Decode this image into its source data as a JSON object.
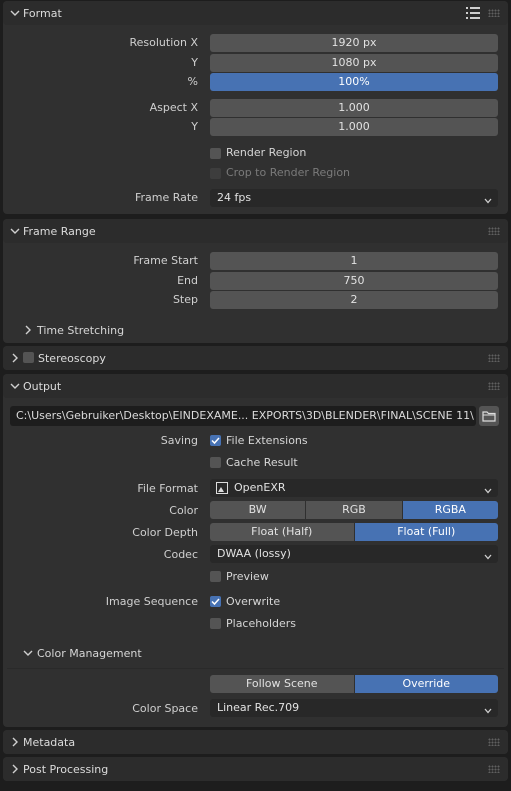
{
  "format": {
    "title": "Format",
    "resolution_x_label": "Resolution X",
    "resolution_x": "1920 px",
    "y_label": "Y",
    "resolution_y": "1080 px",
    "percent_label": "%",
    "percent": "100%",
    "aspect_x_label": "Aspect X",
    "aspect_x": "1.000",
    "aspect_y_label": "Y",
    "aspect_y": "1.000",
    "render_region": "Render Region",
    "crop_region": "Crop to Render Region",
    "frame_rate_label": "Frame Rate",
    "frame_rate": "24 fps"
  },
  "frame_range": {
    "title": "Frame Range",
    "start_label": "Frame Start",
    "start": "1",
    "end_label": "End",
    "end": "750",
    "step_label": "Step",
    "step": "2",
    "time_stretching": "Time Stretching"
  },
  "stereoscopy": {
    "title": "Stereoscopy"
  },
  "output": {
    "title": "Output",
    "path": "C:\\Users\\Gebruiker\\Desktop\\EINDEXAME... EXPORTS\\3D\\BLENDER\\FINAL\\SCENE 11\\",
    "saving_label": "Saving",
    "file_extensions": "File Extensions",
    "cache_result": "Cache Result",
    "file_format_label": "File Format",
    "file_format": "OpenEXR",
    "color_label": "Color",
    "color_options": [
      "BW",
      "RGB",
      "RGBA"
    ],
    "color_depth_label": "Color Depth",
    "color_depth_options": [
      "Float (Half)",
      "Float (Full)"
    ],
    "codec_label": "Codec",
    "codec": "DWAA (lossy)",
    "preview": "Preview",
    "image_sequence_label": "Image Sequence",
    "overwrite": "Overwrite",
    "placeholders": "Placeholders",
    "color_management": "Color Management",
    "cm_options": [
      "Follow Scene",
      "Override"
    ],
    "color_space_label": "Color Space",
    "color_space": "Linear Rec.709"
  },
  "metadata": {
    "title": "Metadata"
  },
  "post_processing": {
    "title": "Post Processing"
  },
  "colors": {
    "accent": "#4772b3",
    "panel": "#303030",
    "field": "#545454"
  },
  "icons": [
    "chevron-down-icon",
    "chevron-right-icon",
    "list-icon",
    "drag-grip-icon",
    "folder-icon",
    "image-file-icon",
    "checkmark-icon"
  ]
}
